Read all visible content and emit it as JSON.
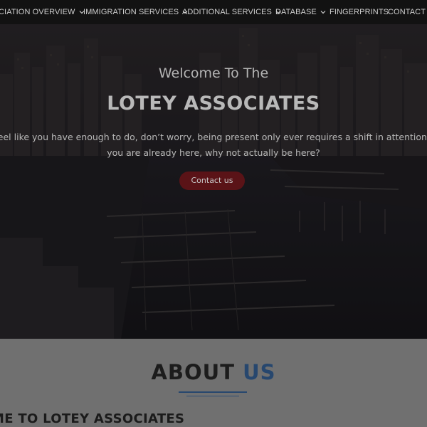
{
  "nav": {
    "items": [
      {
        "label": "CIATION OVERVIEW",
        "has_dropdown": true
      },
      {
        "label": "IMMIGRATION SERVICES",
        "has_dropdown": true
      },
      {
        "label": "ADDITIONAL SERVICES",
        "has_dropdown": true
      },
      {
        "label": "DATABASE",
        "has_dropdown": true
      },
      {
        "label": "FINGERPRINTS",
        "has_dropdown": false
      },
      {
        "label": "CONTACT U",
        "has_dropdown": false
      }
    ]
  },
  "hero": {
    "welcome": "Welcome To The",
    "brand": "LOTEY ASSOCIATES",
    "tagline_line1": "u feel like you have enough to do, don’t worry, being present only ever requires a shift in attention an",
    "tagline_line2": "you are already here, why not actually be here?",
    "cta_label": "Contact us"
  },
  "about": {
    "title_part1": "ABOUT ",
    "title_part2": "US",
    "subtitle": "ME TO LOTEY ASSOCIATES"
  },
  "colors": {
    "nav_bg": "#121212",
    "cta_bg": "#5a1317",
    "accent_blue": "#27476e",
    "about_bg": "#707070"
  },
  "icons": {
    "dropdown": "chevron-down-icon"
  }
}
